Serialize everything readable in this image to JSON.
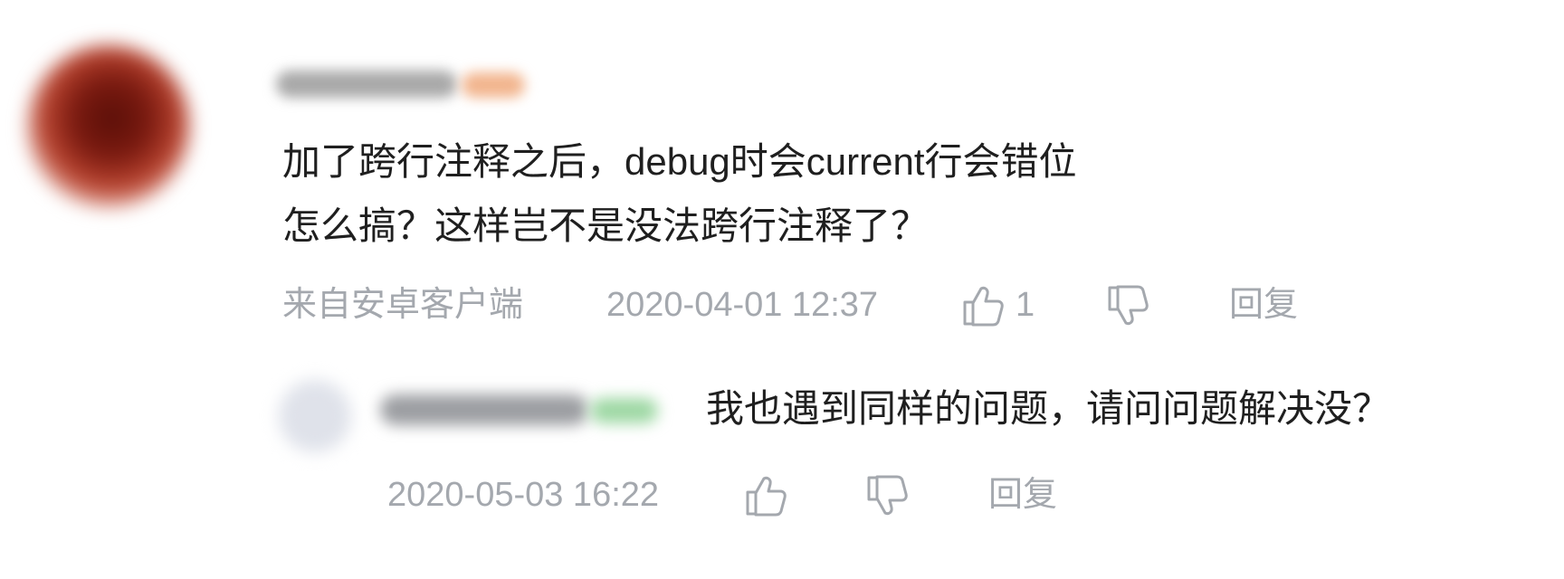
{
  "comment": {
    "text_line_1": "加了跨行注释之后，debug时会current行会错位",
    "text_line_2": "怎么搞？这样岂不是没法跨行注释了？",
    "source": "来自安卓客户端",
    "timestamp": "2020-04-01 12:37",
    "like_count": "1",
    "reply_label": "回复"
  },
  "reply": {
    "text": "我也遇到同样的问题，请问问题解决没？",
    "timestamp": "2020-05-03 16:22",
    "reply_label": "回复"
  },
  "icons": {
    "like": "thumbs-up-icon",
    "dislike": "thumbs-down-icon"
  },
  "colors": {
    "text": "#1f1f1f",
    "meta": "#a4a8ae"
  }
}
